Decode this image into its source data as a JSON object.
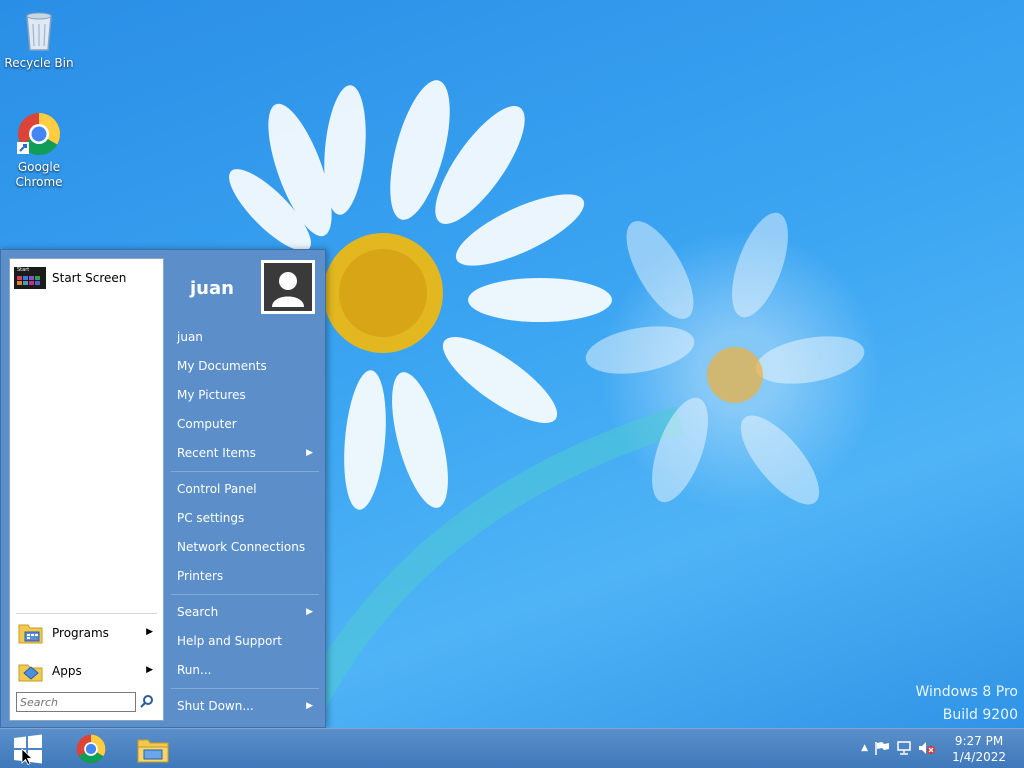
{
  "desktop": {
    "icons": [
      {
        "label": "Recycle Bin"
      },
      {
        "label": "Google\nChrome"
      }
    ],
    "watermark": {
      "line1": "Windows 8 Pro",
      "line2": "Build 9200"
    }
  },
  "start_menu": {
    "left": {
      "pinned_label": "Start Screen",
      "pinned_thumb_text": "Start",
      "programs_label": "Programs",
      "apps_label": "Apps",
      "search_placeholder": "Search"
    },
    "right": {
      "user_name": "juan",
      "items": [
        {
          "label": "juan"
        },
        {
          "label": "My Documents"
        },
        {
          "label": "My Pictures"
        },
        {
          "label": "Computer"
        },
        {
          "label": "Recent Items",
          "submenu": true
        },
        {
          "label": "Control Panel"
        },
        {
          "label": "PC settings"
        },
        {
          "label": "Network Connections"
        },
        {
          "label": "Printers"
        },
        {
          "label": "Search",
          "submenu": true
        },
        {
          "label": "Help and Support"
        },
        {
          "label": "Run..."
        },
        {
          "label": "Shut Down...",
          "submenu": true
        }
      ]
    }
  },
  "taskbar": {
    "clock": {
      "time": "9:27 PM",
      "date": "1/4/2022"
    }
  },
  "colors": {
    "accent": "#5c8fc9",
    "taskbar": "#4a83c2"
  }
}
